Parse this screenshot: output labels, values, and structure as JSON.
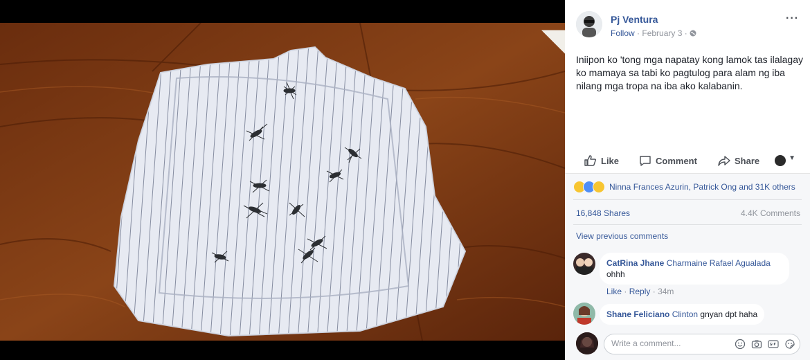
{
  "post": {
    "author": "Pj Ventura",
    "follow_label": "Follow",
    "dot": "·",
    "date": "February 3",
    "dot2": "·",
    "more_label": "···",
    "text": "Iniipon ko 'tong mga napatay kong lamok tas ilalagay ko mamaya sa tabi ko pagtulog para alam ng iba nilang mga tropa na iba ako kalabanin."
  },
  "actions": {
    "like_label": "Like",
    "comment_label": "Comment",
    "share_label": "Share"
  },
  "reactions": {
    "icons": [
      "haha-icon",
      "like-icon",
      "sad-icon"
    ],
    "names": "Ninna Frances Azurin, Patrick Ong and 31K others"
  },
  "stats": {
    "shares": "16,848 Shares",
    "comments": "4.4K Comments"
  },
  "comments": {
    "view_previous": "View previous comments",
    "items": [
      {
        "name": "CatRina Jhane",
        "tag": "Charmaine Rafael Agualada",
        "text": "ohhh",
        "like_label": "Like",
        "reply_label": "Reply",
        "sep": "·",
        "sep2": "·",
        "time": "34m"
      },
      {
        "name": "Shane Feliciano",
        "tag": "Clinton",
        "text": "gnyan dpt haha"
      }
    ],
    "write_placeholder": "Write a comment..."
  },
  "colors": {
    "link": "#365899",
    "muted": "#90949c",
    "panel": "#f6f7f9"
  }
}
